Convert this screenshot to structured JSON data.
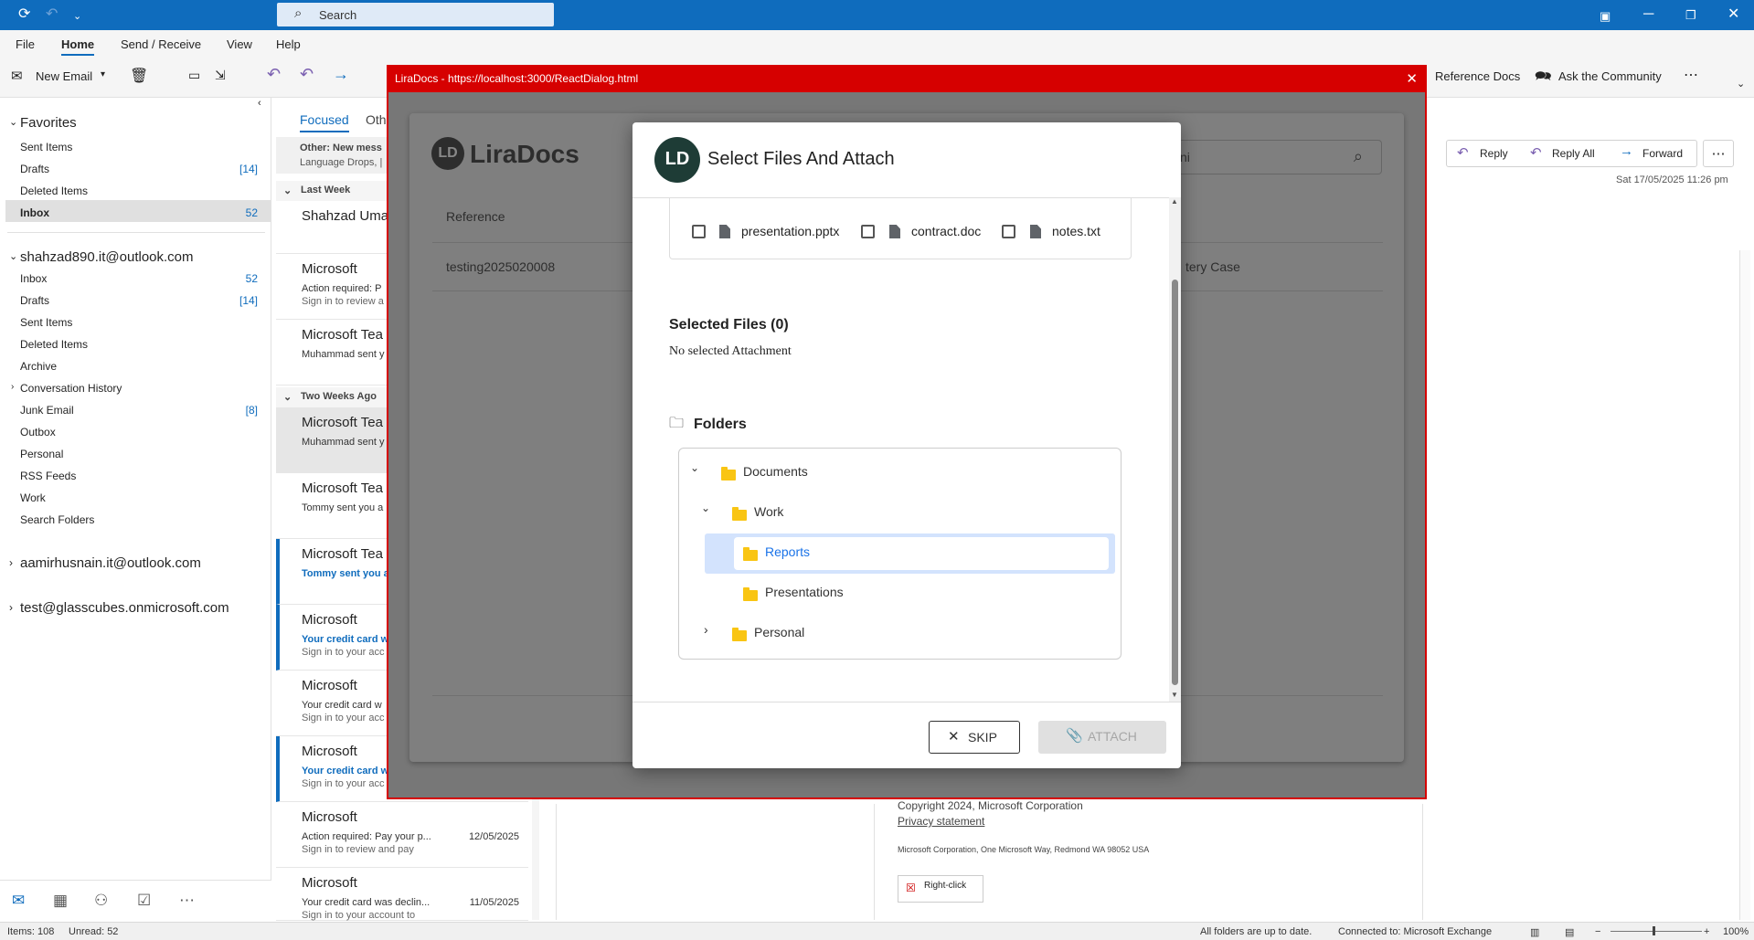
{
  "titlebar": {
    "search_placeholder": "Search"
  },
  "menu": {
    "file": "File",
    "home": "Home",
    "send_receive": "Send / Receive",
    "view": "View",
    "help": "Help"
  },
  "ribbon": {
    "new_email": "New Email",
    "reference_docs": "Reference Docs",
    "ask_community": "Ask the Community"
  },
  "folders": {
    "favorites_label": "Favorites",
    "favorites": [
      {
        "label": "Sent Items",
        "count": ""
      },
      {
        "label": "Drafts",
        "count": "[14]"
      },
      {
        "label": "Deleted Items",
        "count": ""
      },
      {
        "label": "Inbox",
        "count": "52"
      }
    ],
    "account1": "shahzad890.it@outlook.com",
    "account1_items": [
      {
        "label": "Inbox",
        "count": "52"
      },
      {
        "label": "Drafts",
        "count": "[14]"
      },
      {
        "label": "Sent Items",
        "count": ""
      },
      {
        "label": "Deleted Items",
        "count": ""
      },
      {
        "label": "Archive",
        "count": ""
      },
      {
        "label": "Conversation History",
        "count": ""
      },
      {
        "label": "Junk Email",
        "count": "[8]"
      },
      {
        "label": "Outbox",
        "count": ""
      },
      {
        "label": "Personal",
        "count": ""
      },
      {
        "label": "RSS Feeds",
        "count": ""
      },
      {
        "label": "Work",
        "count": ""
      },
      {
        "label": "Search Folders",
        "count": ""
      }
    ],
    "account2": "aamirhusnain.it@outlook.com",
    "account3": "test@glasscubes.onmicrosoft.com"
  },
  "msglist": {
    "tab_focused": "Focused",
    "tab_other": "Oth",
    "other_banner_title": "Other: New mess",
    "other_banner_sub": "Language Drops, |",
    "group_last_week": "Last Week",
    "group_two_weeks": "Two Weeks Ago",
    "messages": [
      {
        "from": "Shahzad Umar",
        "subj": "",
        "prev": "",
        "date": ""
      },
      {
        "from": "Microsoft",
        "subj": "Action required: P",
        "prev": "Sign in to review a",
        "date": ""
      },
      {
        "from": "Microsoft Tea",
        "subj": "Muhammad sent y",
        "prev": "",
        "date": ""
      },
      {
        "from": "Microsoft Tea",
        "subj": "Muhammad sent y",
        "prev": "",
        "date": ""
      },
      {
        "from": "Microsoft Tea",
        "subj": "Tommy sent you a",
        "prev": "",
        "date": ""
      },
      {
        "from": "Microsoft Tea",
        "subj": "Tommy sent you a",
        "prev": "",
        "date": ""
      },
      {
        "from": "Microsoft",
        "subj": "Your credit card w",
        "prev": "Sign in to your acc",
        "date": ""
      },
      {
        "from": "Microsoft",
        "subj": "Your credit card w",
        "prev": "Sign in to your acc",
        "date": ""
      },
      {
        "from": "Microsoft",
        "subj": "Your credit card w",
        "prev": "Sign in to your acc",
        "date": ""
      },
      {
        "from": "Microsoft",
        "subj": "Action required: Pay your p...",
        "prev": "Sign in to review and pay",
        "date": "12/05/2025"
      },
      {
        "from": "Microsoft",
        "subj": "Your credit card was declin...",
        "prev": "Sign in to your account to",
        "date": "11/05/2025"
      }
    ]
  },
  "reading": {
    "reply": "Reply",
    "reply_all": "Reply All",
    "forward": "Forward",
    "date": "Sat 17/05/2025 11:26 pm",
    "copyright": "Copyright 2024, Microsoft Corporation",
    "privacy": "Privacy statement",
    "address": "Microsoft Corporation, One Microsoft Way, Redmond WA 98052 USA",
    "rightclick": "Right-click"
  },
  "addin": {
    "title": "LiraDocs - https://localhost:3000/ReactDialog.html",
    "logo_text": "LiraDocs",
    "search_partial": "ni",
    "col_reference": "Reference",
    "row_reference": "testing2025020008",
    "row_case": "tery Case"
  },
  "dialog": {
    "title": "Select Files And Attach",
    "files": [
      "presentation.pptx",
      "contract.doc",
      "notes.txt"
    ],
    "selected_files_label": "Selected Files (0)",
    "no_selected": "No selected Attachment",
    "folders_label": "Folders",
    "tree": {
      "documents": "Documents",
      "work": "Work",
      "reports": "Reports",
      "presentations": "Presentations",
      "personal": "Personal"
    },
    "skip": "SKIP",
    "attach": "ATTACH"
  },
  "status": {
    "items": "Items: 108",
    "unread": "Unread: 52",
    "folders_uptodate": "All folders are up to date.",
    "connected": "Connected to: Microsoft Exchange",
    "zoom": "100%"
  },
  "colors": {
    "brand": "#0f6cbd",
    "addin_border": "#d60000",
    "selected_tree": "#d3e3fd"
  }
}
